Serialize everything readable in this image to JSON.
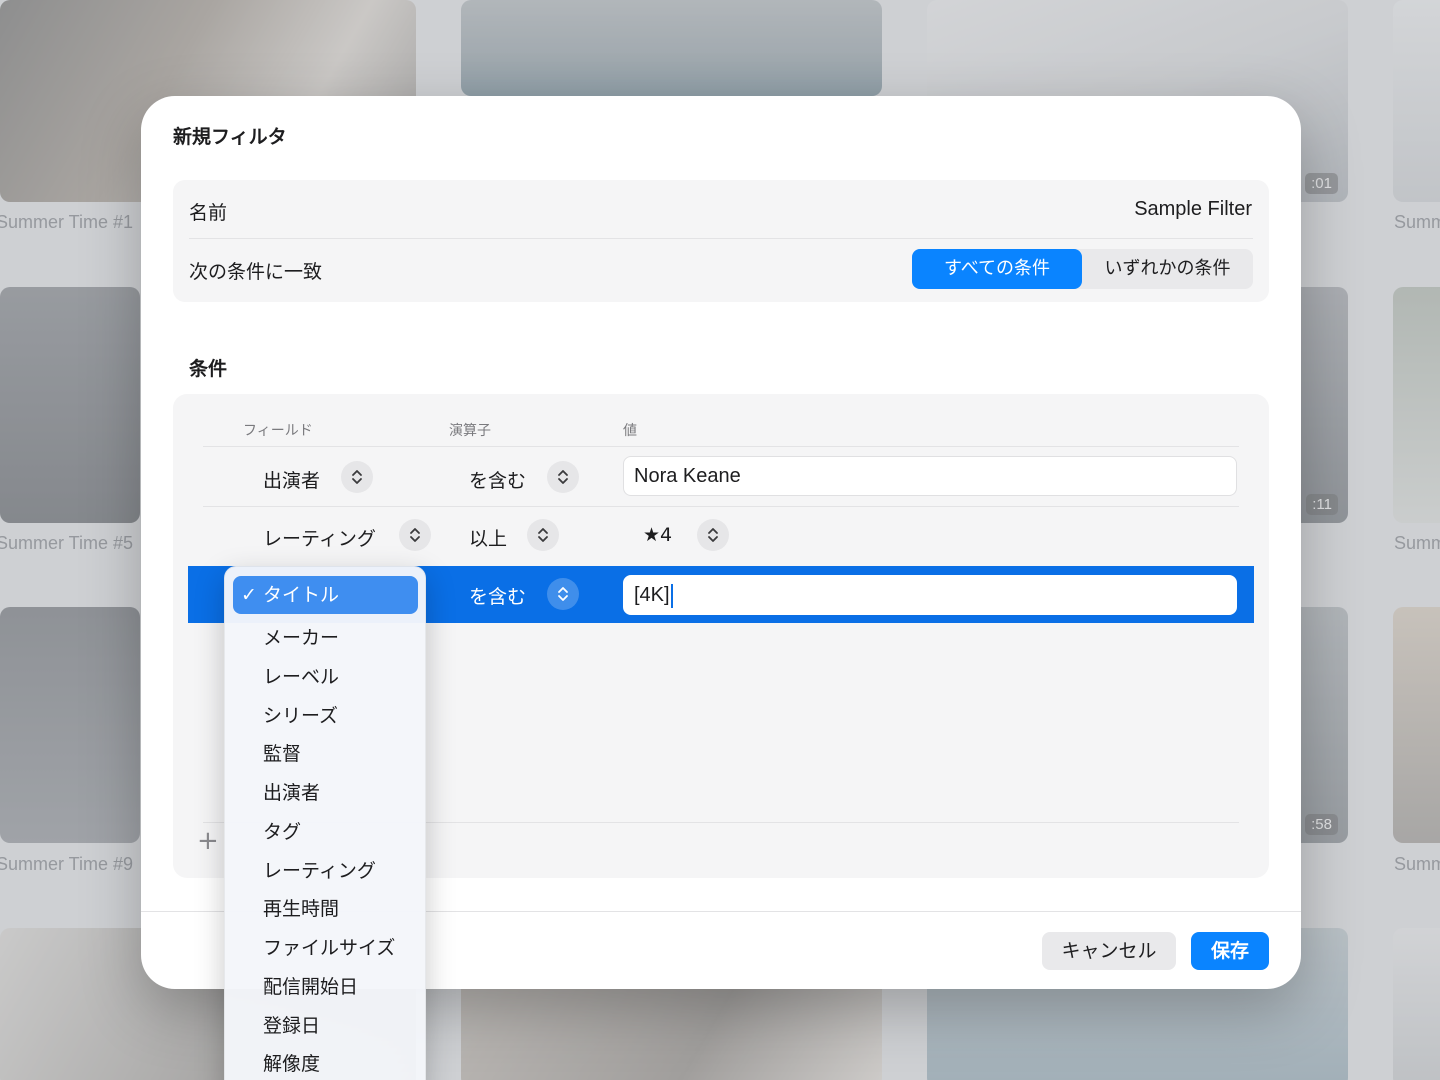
{
  "background": {
    "captions": [
      "Summer Time #1",
      "Summer Time #5",
      "Summer Time #9",
      "Summ",
      "Summ",
      "Summ"
    ],
    "durations": [
      ":01",
      ":11",
      ":58"
    ]
  },
  "dialog": {
    "title": "新規フィルタ",
    "name_label": "名前",
    "name_value": "Sample Filter",
    "match_label": "次の条件に一致",
    "match_options": [
      "すべての条件",
      "いずれかの条件"
    ],
    "match_selected": "すべての条件",
    "conditions_title": "条件",
    "columns": {
      "field": "フィールド",
      "operator": "演算子",
      "value": "値"
    },
    "rows": [
      {
        "field": "出演者",
        "operator": "を含む",
        "value": "Nora Keane"
      },
      {
        "field": "レーティング",
        "operator": "以上",
        "value": "★4"
      },
      {
        "field": "タイトル",
        "operator": "を含む",
        "value": "[4K]"
      }
    ],
    "add_symbol": "+",
    "cancel": "キャンセル",
    "save": "保存"
  },
  "menu": {
    "check": "✓",
    "items": [
      "タイトル",
      "メーカー",
      "レーベル",
      "シリーズ",
      "監督",
      "出演者",
      "タグ",
      "レーティング",
      "再生時間",
      "ファイルサイズ",
      "配信開始日",
      "登録日",
      "解像度"
    ],
    "selected": "タイトル"
  },
  "colors": {
    "accent": "#0a84ff",
    "selected_row": "#0a6fe6"
  }
}
